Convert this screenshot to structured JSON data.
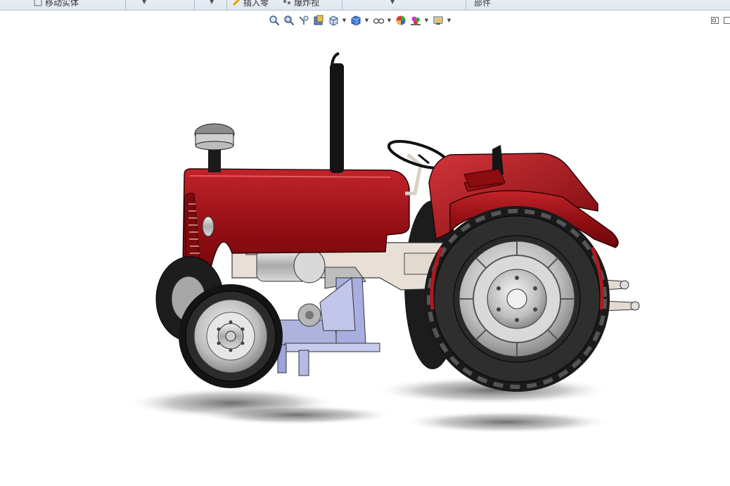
{
  "command_manager": {
    "item1_label": "移动实体",
    "item2_label": "插入零",
    "item3_label": "爆炸视",
    "item4_label": "部件"
  },
  "hud_toolbar": {
    "buttons": [
      {
        "icon": "zoom-to-fit-icon"
      },
      {
        "icon": "zoom-to-area-icon"
      },
      {
        "icon": "previous-view-icon"
      },
      {
        "icon": "section-view-icon"
      },
      {
        "icon": "view-orientation-icon"
      },
      {
        "icon": "display-style-icon"
      },
      {
        "icon": "hide-show-items-icon"
      },
      {
        "icon": "edit-appearance-icon"
      },
      {
        "icon": "apply-scene-icon"
      },
      {
        "icon": "view-settings-icon"
      }
    ]
  },
  "colors": {
    "body_red": "#8e0d12",
    "body_red_light": "#c2242a",
    "tire": "#1a1a1a",
    "frame_beige": "#e8e0d6",
    "bracket_blue": "#aeb3de",
    "chrome": "#cfcfcf"
  }
}
